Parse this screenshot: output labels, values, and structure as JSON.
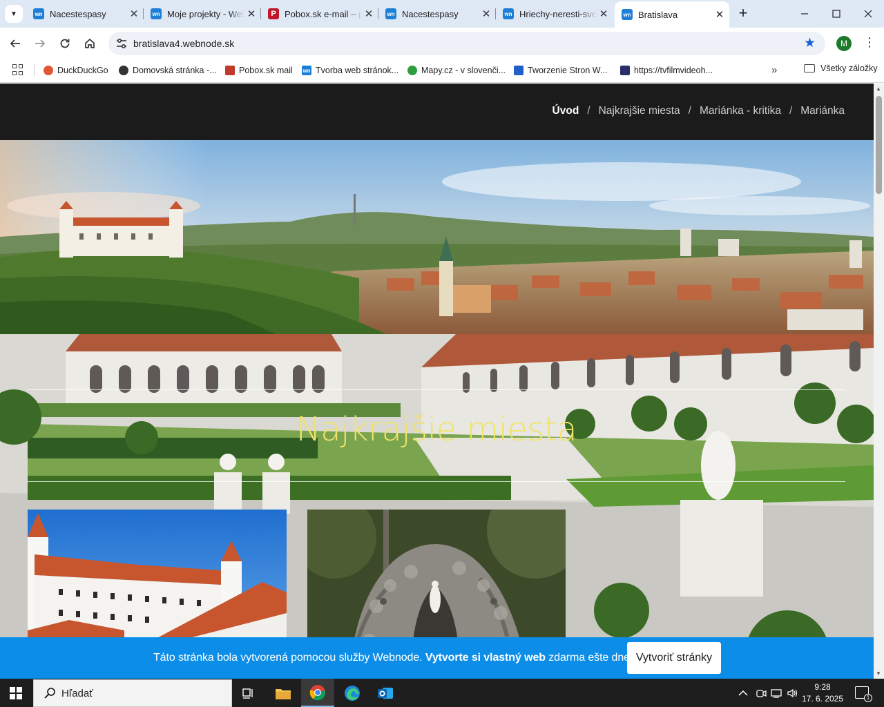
{
  "browser": {
    "tabs": [
      {
        "title": "Nacestespasy",
        "favicon": "webnode-icon",
        "active": false
      },
      {
        "title": "Moje projekty - Webnode",
        "favicon": "webnode-icon",
        "active": false
      },
      {
        "title": "Pobox.sk e-mail – prihlásenie",
        "favicon": "pobox-icon",
        "active": false
      },
      {
        "title": "Nacestespasy",
        "favicon": "webnode-icon",
        "active": false
      },
      {
        "title": "Hriechy-neresti-svet",
        "favicon": "webnode-icon",
        "active": false
      },
      {
        "title": "Bratislava",
        "favicon": "webnode-icon",
        "active": true
      }
    ],
    "favicon_text": "wn",
    "pobox_favicon_text": "P",
    "url": "bratislava4.webnode.sk",
    "profile_initial": "M",
    "bookmarks": [
      {
        "label": "DuckDuckGo",
        "color": "#de5833"
      },
      {
        "label": "Domovská stránka -...",
        "color": "#333333"
      },
      {
        "label": "Pobox.sk mail",
        "color": "#c0392b"
      },
      {
        "label": "Tvorba web stránok...",
        "color": "#1e7fd6"
      },
      {
        "label": "Mapy.cz - v slovenči...",
        "color": "#2e9e3e"
      },
      {
        "label": "Tworzenie Stron W...",
        "color": "#1e5fc9"
      },
      {
        "label": "https://tvfilmvideoh...",
        "color": "#2a2f6b"
      }
    ],
    "all_bookmarks_label": "Všetky záložky"
  },
  "site": {
    "breadcrumb": [
      "Úvod",
      "Najkrajšie miesta",
      "Mariánka - kritika",
      "Mariánka"
    ],
    "section_title": "Najkrajšie miesta",
    "banner": {
      "text_before": "Táto stránka bola vytvorená pomocou služby Webnode. ",
      "text_bold": "Vytvorte si vlastný web",
      "text_after": " zdarma ešte dnes!",
      "button": "Vytvoriť stránky"
    },
    "colors": {
      "accent_title": "#f1e36a",
      "banner_bg": "#0b8de8",
      "nav_bg": "#1b1b1b"
    }
  },
  "taskbar": {
    "search_placeholder": "Hľadať",
    "time": "9:28",
    "date": "17. 6. 2025",
    "notification_count": "1"
  }
}
